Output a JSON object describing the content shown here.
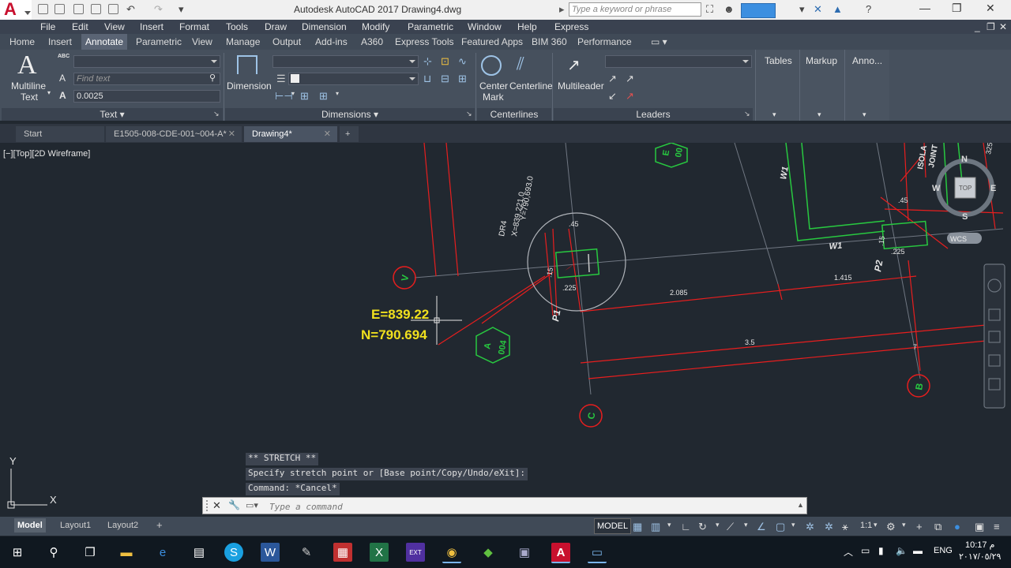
{
  "titlebar": {
    "title": "Autodesk AutoCAD 2017    Drawing4.dwg",
    "search_placeholder": "Type a keyword or phrase",
    "logo_letter": "A"
  },
  "menubar": [
    "File",
    "Edit",
    "View",
    "Insert",
    "Format",
    "Tools",
    "Draw",
    "Dimension",
    "Modify",
    "Parametric",
    "Window",
    "Help",
    "Express"
  ],
  "ribbon_tabs": [
    "Home",
    "Insert",
    "Annotate",
    "Parametric",
    "View",
    "Manage",
    "Output",
    "Add-ins",
    "A360",
    "Express Tools",
    "Featured Apps",
    "BIM 360",
    "Performance"
  ],
  "ribbon": {
    "text_panel": {
      "multiline_line1": "Multiline",
      "multiline_line2": "Text",
      "find_placeholder": "Find text",
      "height_value": "0.0025",
      "title": "Text",
      "abc_label": "ABC"
    },
    "dimensions_panel": {
      "dimension_label": "Dimension",
      "title": "Dimensions"
    },
    "centerlines_panel": {
      "center_mark_line1": "Center",
      "center_mark_line2": "Mark",
      "centerline_label": "Centerline",
      "title": "Centerlines"
    },
    "leaders_panel": {
      "multileader_label": "Multileader",
      "title": "Leaders"
    },
    "tables_label": "Tables",
    "markup_label": "Markup",
    "anno_label": "Anno..."
  },
  "file_tabs": [
    {
      "label": "Start"
    },
    {
      "label": "E1505-008-CDE-001~004-A*"
    },
    {
      "label": "Drawing4*"
    }
  ],
  "viewport_label": "[−][Top][2D Wireframe]",
  "drawing": {
    "easting": "E=839.22",
    "northing": "N=790.694",
    "dr4_label": "DR4",
    "dr4_x": "X=839,221.0",
    "dr4_y": "Y=790,693.0",
    "dim_45_a": ".45",
    "dim_45_b": ".45",
    "dim_15_a": ".15",
    "dim_15_b": ".15",
    "dim_225_a": ".225",
    "dim_225_b": ".225",
    "dim_2085": "2.085",
    "dim_1415": "1.415",
    "dim_35": "3.5",
    "dim_7": "7",
    "dim_325": "325",
    "grid_v": "V",
    "grid_a": "A",
    "grid_b": "B",
    "grid_c": "C",
    "tag_004": "004",
    "tag_e": "E",
    "tag_00": "00",
    "p1": "P1",
    "p2": "P2",
    "w1_a": "W1",
    "w1_b": "W1",
    "isola": "ISOLA",
    "joint": "JOINT"
  },
  "viewcube": {
    "n": "N",
    "s": "S",
    "e": "E",
    "w": "W",
    "top": "TOP",
    "wcs": "WCS"
  },
  "ucs": {
    "x": "X",
    "y": "Y"
  },
  "command": {
    "history": [
      "** STRETCH **",
      "Specify stretch point or [Base point/Copy/Undo/eXit]:",
      "Command: *Cancel*"
    ],
    "placeholder": "Type a command"
  },
  "layout_tabs": [
    "Model",
    "Layout1",
    "Layout2"
  ],
  "status": {
    "model": "MODEL",
    "scale": "1:1"
  },
  "taskbar": {
    "lang": "ENG",
    "time": "10:17 م",
    "date": "٢٠١٧/٠٥/٢٩"
  }
}
